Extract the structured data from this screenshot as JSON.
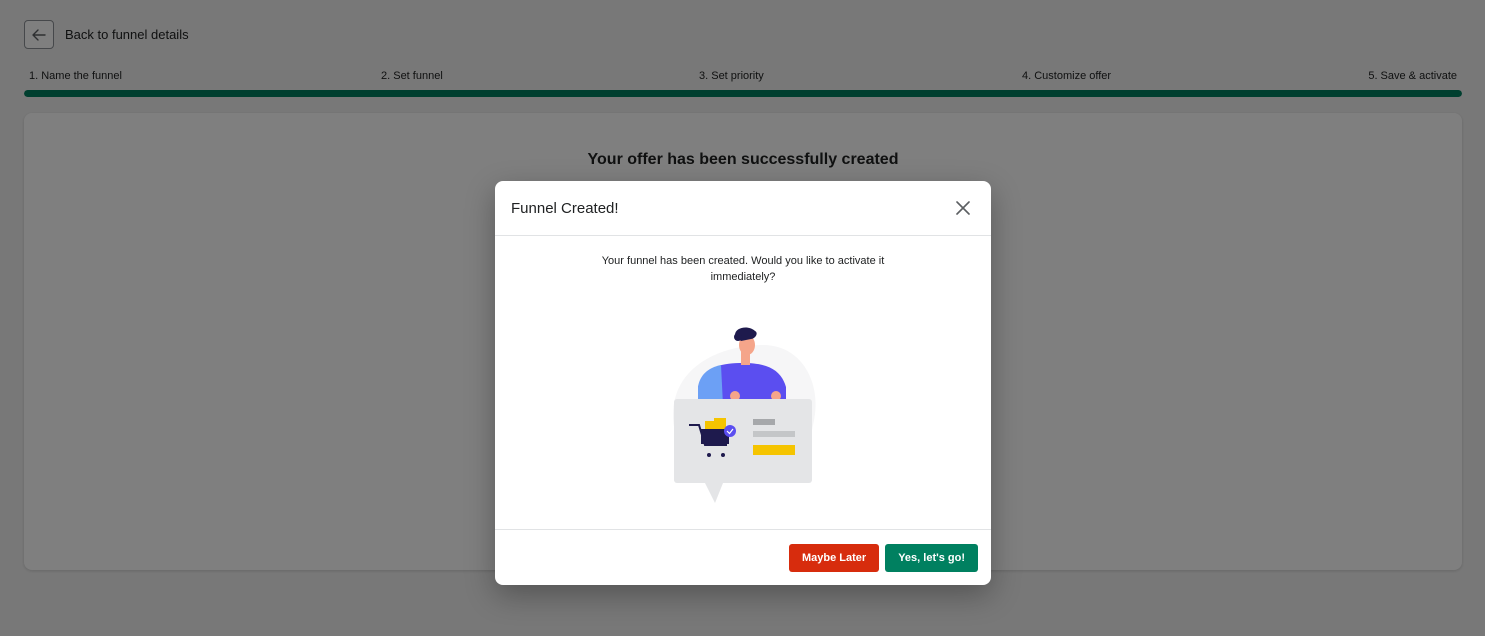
{
  "header": {
    "back_label": "Back to funnel details",
    "back_icon": "arrow-left-icon"
  },
  "steps": [
    {
      "label": "1. Name the funnel"
    },
    {
      "label": "2. Set funnel"
    },
    {
      "label": "3. Set priority"
    },
    {
      "label": "4. Customize offer"
    },
    {
      "label": "5. Save & activate"
    }
  ],
  "progress": {
    "percent": 100,
    "color": "#007f5f"
  },
  "card": {
    "title": "Your offer has been successfully created"
  },
  "modal": {
    "title": "Funnel Created!",
    "close_icon": "close-icon",
    "message": "Your funnel has been created. Would you like to activate it immediately?",
    "illustration": "shopping-cart-illustration",
    "secondary_label": "Maybe Later",
    "primary_label": "Yes, let's go!"
  },
  "colors": {
    "primary": "#008060",
    "danger": "#d72c0d"
  }
}
